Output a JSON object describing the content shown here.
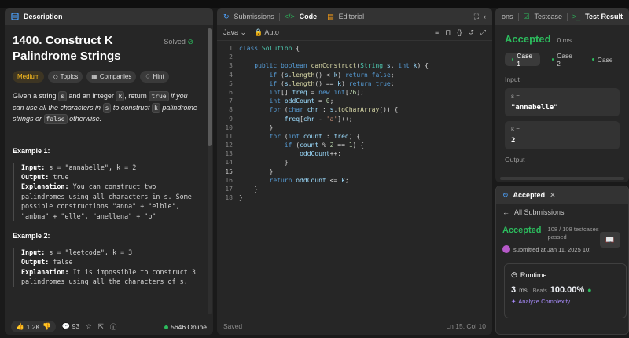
{
  "colors": {
    "accent_green": "#2cbb5d",
    "medium": "#ffc01e",
    "background": "#1a1a1a",
    "panel": "#262626"
  },
  "description_panel": {
    "tab": "Description",
    "title": "1400. Construct K Palindrome Strings",
    "status": "Solved",
    "tags": [
      "Medium",
      "Topics",
      "Companies",
      "Hint"
    ],
    "prose": {
      "p1": "Given a string",
      "s": "s",
      "p2": "and an integer",
      "k": "k",
      "p3": ", return",
      "true_chip": "true",
      "p4": "if you can use all the characters in",
      "s2": "s",
      "p5": "to construct",
      "k2": "k",
      "p6": "palindrome strings or",
      "false_chip": "false",
      "p7": "otherwise."
    },
    "example1": {
      "title": "Example 1:",
      "input_label": "Input:",
      "input": "s = \"annabelle\", k = 2",
      "output_label": "Output:",
      "output": "true",
      "explanation_label": "Explanation:",
      "explanation": "You can construct two palindromes using all characters in s. Some possible constructions \"anna\" + \"elble\", \"anbna\" + \"elle\", \"anellena\" + \"b\""
    },
    "example2": {
      "title": "Example 2:",
      "input_label": "Input:",
      "input": "s = \"leetcode\", k = 3",
      "output_label": "Output:",
      "output": "false",
      "explanation_label": "Explanation:",
      "explanation": "It is impossible to construct 3 palindromes using all the characters of s."
    },
    "footer": {
      "likes": "1.2K",
      "comments": "93",
      "online": "5646 Online"
    }
  },
  "code_panel": {
    "tabs": [
      "Submissions",
      "Code",
      "Editorial"
    ],
    "language": "Java",
    "auto": "Auto",
    "status": "Saved",
    "cursor": "Ln 15, Col 10"
  },
  "test_panel": {
    "tabs": [
      "ons",
      "Testcase",
      "Test Result"
    ],
    "verdict": "Accepted",
    "runtime": "0 ms",
    "cases": [
      "Case 1",
      "Case 2",
      "Case"
    ],
    "input_label": "Input",
    "s_label": "s =",
    "s_value": "\"annabelle\"",
    "k_label": "k =",
    "k_value": "2",
    "output_label": "Output"
  },
  "submission_panel": {
    "tab": "Accepted",
    "back": "All Submissions",
    "verdict": "Accepted",
    "testcases": "108 / 108 testcases",
    "passed": "passed",
    "submitted": "submitted at Jan 11, 2025 10:",
    "runtime_label": "Runtime",
    "runtime_value": "3",
    "runtime_unit": "ms",
    "beats_label": "Beats",
    "beats_value": "100.00%",
    "analyze": "Analyze Complexity"
  }
}
